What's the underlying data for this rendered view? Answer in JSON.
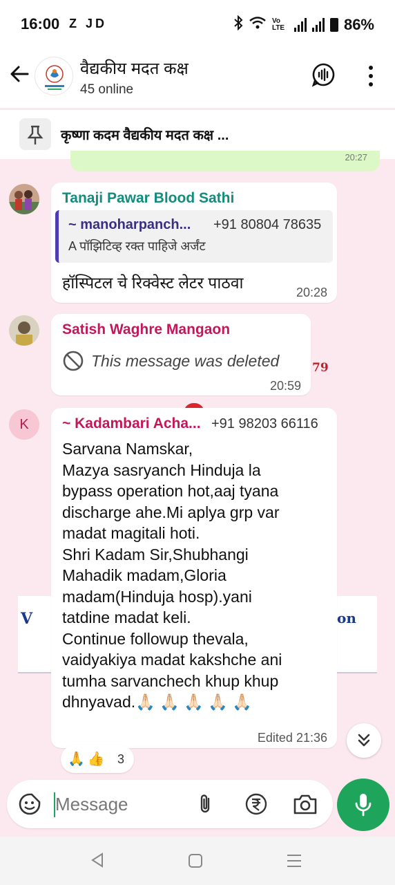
{
  "status_bar": {
    "time": "16:00",
    "left_icons": "Z JD",
    "battery": "86%",
    "network": "Vo LTE"
  },
  "header": {
    "title": "वैद्यकीय मदत कक्ष",
    "subtitle": "45 online"
  },
  "pinned": {
    "text": "कृष्णा कदम वैद्यकीय मदत कक्ष ..."
  },
  "previous_message": {
    "time": "20:27"
  },
  "messages": [
    {
      "sender": "Tanaji Pawar Blood Sathi",
      "sender_color": "#128c7e",
      "quote": {
        "sender": "~ manoharpanch...",
        "phone": "+91 80804 78635",
        "text": "A पॉझिटिव्ह रक्त पाहिजे अर्जंट"
      },
      "text": "हॉस्पिटल चे रिक्वेस्ट लेटर पाठवा",
      "time": "20:28"
    },
    {
      "sender": "Satish Waghre Mangaon",
      "sender_color": "#c2185b",
      "deleted_text": "This message was deleted",
      "time": "20:59"
    },
    {
      "avatar_letter": "K",
      "sender": "~ Kadambari Acha...",
      "sender_color": "#c2185b",
      "phone": "+91 98203 66116",
      "lines": [
        "Sarvana Namskar,",
        "Mazya sasryanch Hinduja la",
        "bypass operation hot,aaj tyana",
        "discharge ahe.Mi aplya grp var",
        "madat magitali hoti.",
        "Shri Kadam Sir,Shubhangi",
        "Mahadik madam,Gloria",
        "madam(Hinduja hosp).yani",
        "tatdine madat keli.",
        "Continue followup thevala,",
        "vaidyakiya madat kakshche ani",
        "tumha sarvanchech khup khup",
        "dhnyavad.🙏🏻 🙏🏻 🙏🏻 🙏🏻 🙏🏻"
      ],
      "time": "Edited 21:36",
      "reactions": {
        "emojis": "🙏👍",
        "count": "3"
      }
    }
  ],
  "background_fragments": {
    "badge": "79",
    "left_mark": "V",
    "right_mark": "on"
  },
  "composer": {
    "placeholder": "Message"
  },
  "colors": {
    "accent_green": "#1ea45b",
    "chat_background": "#fce9ef",
    "quote_bar": "#4f3bb0"
  }
}
